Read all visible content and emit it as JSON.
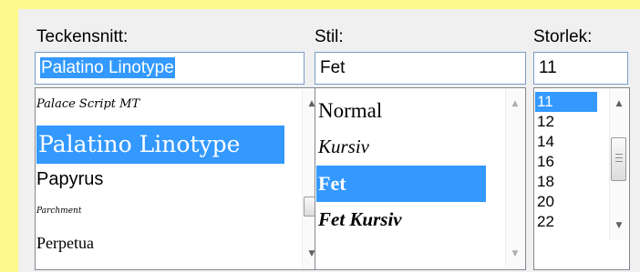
{
  "dialog": {
    "font": {
      "label": "Teckensnitt:",
      "value": "Palatino Linotype",
      "items": [
        "Palace Script MT",
        "Palatino Linotype",
        "Papyrus",
        "Parchment",
        "Perpetua"
      ]
    },
    "style": {
      "label": "Stil:",
      "value": "Fet",
      "items": [
        "Normal",
        "Kursiv",
        "Fet",
        "Fet Kursiv"
      ]
    },
    "size": {
      "label": "Storlek:",
      "value": "11",
      "items": [
        "11",
        "12",
        "14",
        "16",
        "18",
        "20",
        "22"
      ]
    }
  },
  "colors": {
    "background": "#fdfa8b",
    "panel": "#f0f0f0",
    "selection": "#3399ff"
  },
  "icons": {
    "scroll_up": "up-arrow-icon",
    "scroll_down": "down-arrow-icon"
  }
}
